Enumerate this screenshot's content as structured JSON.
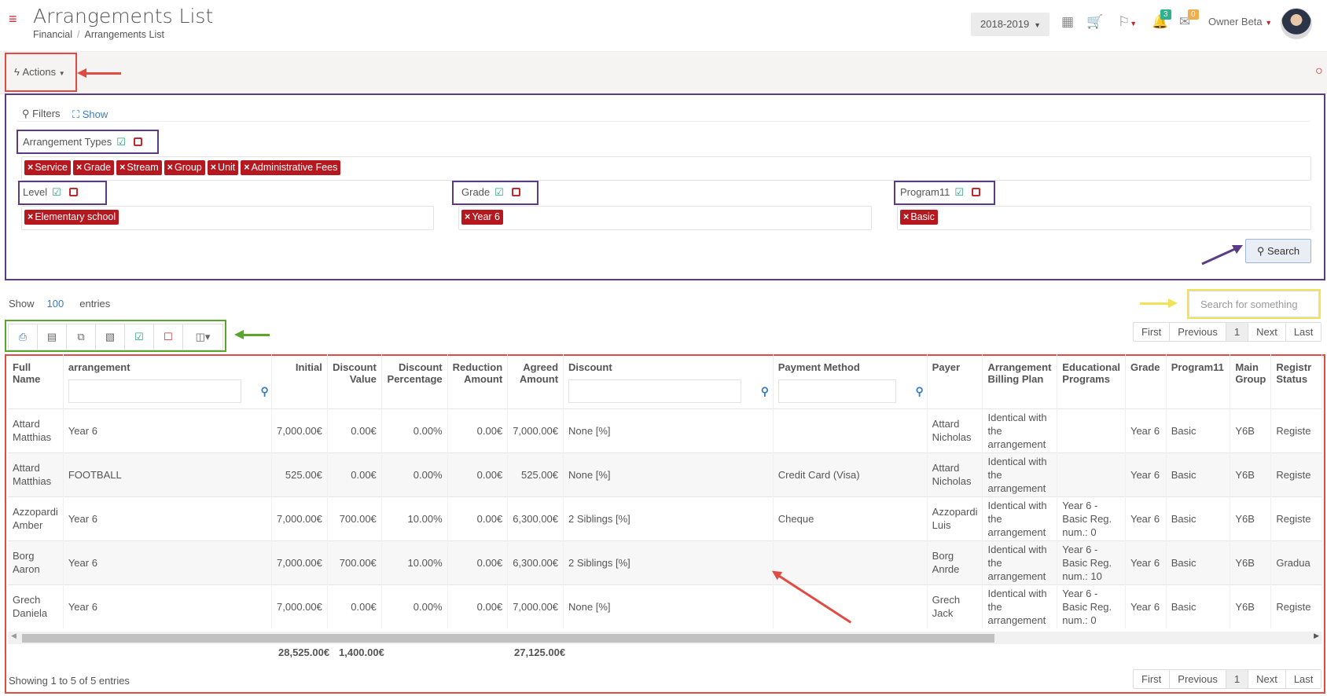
{
  "header": {
    "title": "Arrangements List",
    "breadcrumb": [
      "Financial",
      "Arrangements List"
    ],
    "year": "2018-2019",
    "notifications_count": "3",
    "messages_count": "0",
    "user_name": "Owner Beta"
  },
  "actions": {
    "label": "Actions"
  },
  "filters": {
    "title": "Filters",
    "show_label": "Show",
    "arrangement_types": {
      "label": "Arrangement Types",
      "tags": [
        "Service",
        "Grade",
        "Stream",
        "Group",
        "Unit",
        "Administrative Fees"
      ]
    },
    "level": {
      "label": "Level",
      "tags": [
        "Elementary school"
      ]
    },
    "grade": {
      "label": "Grade",
      "tags": [
        "Year 6"
      ]
    },
    "program": {
      "label": "Program11",
      "tags": [
        "Basic"
      ]
    },
    "search_button": "Search"
  },
  "table_controls": {
    "show": "Show",
    "entries_value": "100",
    "entries": "entries",
    "search_placeholder": "Search for something",
    "pager": [
      "First",
      "Previous",
      "1",
      "Next",
      "Last"
    ]
  },
  "table": {
    "columns": [
      "Full Name",
      "arrangement",
      "Initial",
      "Discount Value",
      "Discount Percentage",
      "Reduction Amount",
      "Agreed Amount",
      "Discount",
      "Payment Method",
      "Payer",
      "Arrangement Billing Plan",
      "Educational Programs",
      "Grade",
      "Program11",
      "Main Group",
      "Registr Status"
    ],
    "rows": [
      [
        "Attard Matthias",
        "Year 6",
        "7,000.00€",
        "0.00€",
        "0.00%",
        "0.00€",
        "7,000.00€",
        "None [%]",
        "",
        "Attard Nicholas",
        "Identical with the arrangement",
        "",
        "Year 6",
        "Basic",
        "Y6B",
        "Registe"
      ],
      [
        "Attard Matthias",
        "FOOTBALL",
        "525.00€",
        "0.00€",
        "0.00%",
        "0.00€",
        "525.00€",
        "None [%]",
        "Credit Card (Visa)",
        "Attard Nicholas",
        "Identical with the arrangement",
        "",
        "Year 6",
        "Basic",
        "Y6B",
        "Registe"
      ],
      [
        "Azzopardi Amber",
        "Year 6",
        "7,000.00€",
        "700.00€",
        "10.00%",
        "0.00€",
        "6,300.00€",
        "2 Siblings [%]",
        "Cheque",
        "Azzopardi Luis",
        "Identical with the arrangement",
        "Year 6 - Basic Reg. num.: 0",
        "Year 6",
        "Basic",
        "Y6B",
        "Registe"
      ],
      [
        "Borg Aaron",
        "Year 6",
        "7,000.00€",
        "700.00€",
        "10.00%",
        "0.00€",
        "6,300.00€",
        "2 Siblings [%]",
        "",
        "Borg Anrde",
        "Identical with the arrangement",
        "Year 6 - Basic Reg. num.: 10",
        "Year 6",
        "Basic",
        "Y6B",
        "Gradua"
      ],
      [
        "Grech Daniela",
        "Year 6",
        "7,000.00€",
        "0.00€",
        "0.00%",
        "0.00€",
        "7,000.00€",
        "None [%]",
        "",
        "Grech Jack",
        "Identical with the arrangement",
        "Year 6 - Basic Reg. num.: 0",
        "Year 6",
        "Basic",
        "Y6B",
        "Registe"
      ]
    ],
    "totals": {
      "initial": "28,525.00€",
      "discount_value": "1,400.00€",
      "agreed_amount": "27,125.00€"
    },
    "showing": "Showing 1 to 5 of 5 entries"
  },
  "colors": {
    "accent_red": "#b5181f",
    "annotation_red": "#e04b43",
    "annotation_purple": "#5b3b86",
    "annotation_green": "#5aa62a",
    "annotation_yellow": "#f0e35a",
    "link_blue": "#3b7bbf"
  }
}
